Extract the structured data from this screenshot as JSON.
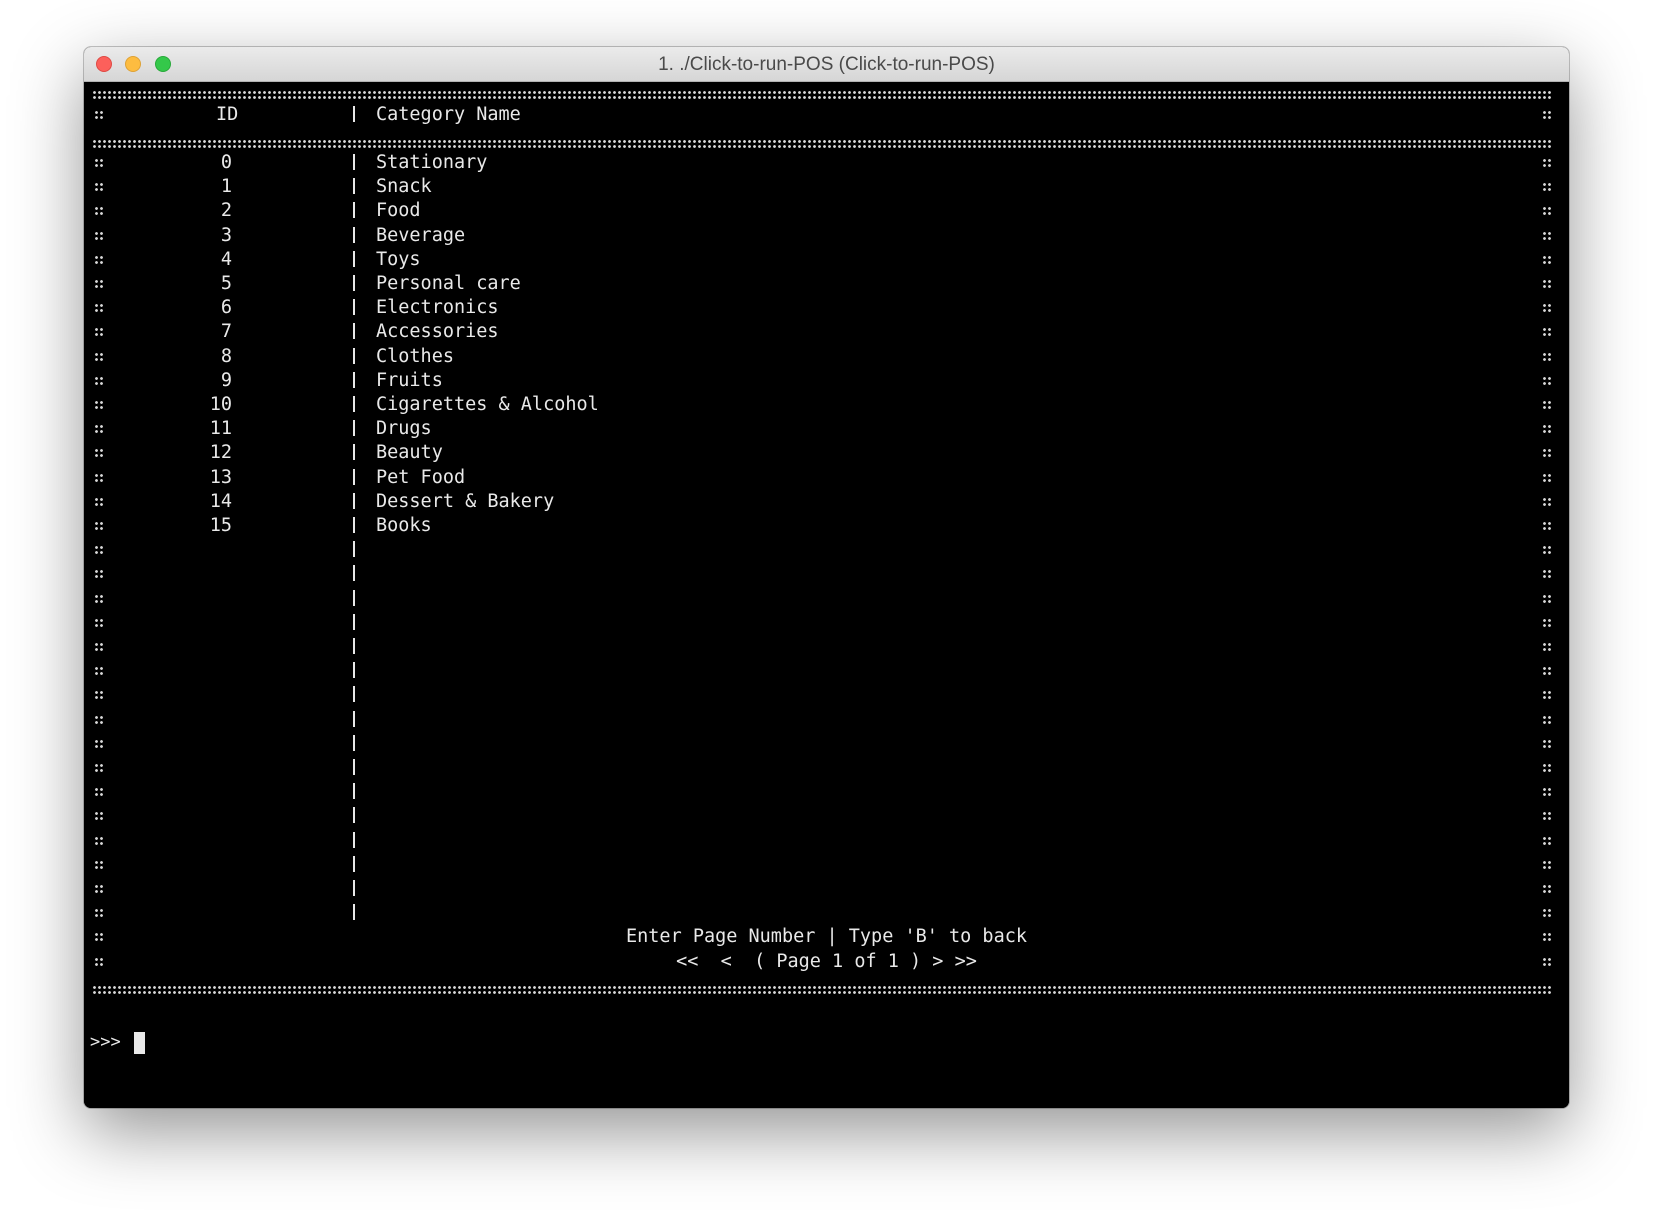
{
  "window": {
    "title": "1. ./Click-to-run-POS (Click-to-run-POS)"
  },
  "table": {
    "headers": {
      "id": "ID",
      "name": "Category Name"
    },
    "rows": [
      {
        "id": "0",
        "name": "Stationary"
      },
      {
        "id": "1",
        "name": "Snack"
      },
      {
        "id": "2",
        "name": "Food"
      },
      {
        "id": "3",
        "name": "Beverage"
      },
      {
        "id": "4",
        "name": "Toys"
      },
      {
        "id": "5",
        "name": "Personal care"
      },
      {
        "id": "6",
        "name": "Electronics"
      },
      {
        "id": "7",
        "name": "Accessories"
      },
      {
        "id": "8",
        "name": "Clothes"
      },
      {
        "id": "9",
        "name": "Fruits"
      },
      {
        "id": "10",
        "name": "Cigarettes & Alcohol"
      },
      {
        "id": "11",
        "name": "Drugs"
      },
      {
        "id": "12",
        "name": "Beauty"
      },
      {
        "id": "13",
        "name": "Pet Food"
      },
      {
        "id": "14",
        "name": "Dessert & Bakery"
      },
      {
        "id": "15",
        "name": "Books"
      }
    ],
    "empty_rows": 16
  },
  "footer": {
    "instruction": "Enter Page Number | Type 'B' to back",
    "pagination": "<<  <  ( Page 1 of 1 ) > >>"
  },
  "prompt": {
    "symbol": ">>>"
  },
  "colors": {
    "background": "#000000",
    "text": "#e9e9e9",
    "close": "#fc605b",
    "minimize": "#fdbc40",
    "maximize": "#34c84a"
  }
}
